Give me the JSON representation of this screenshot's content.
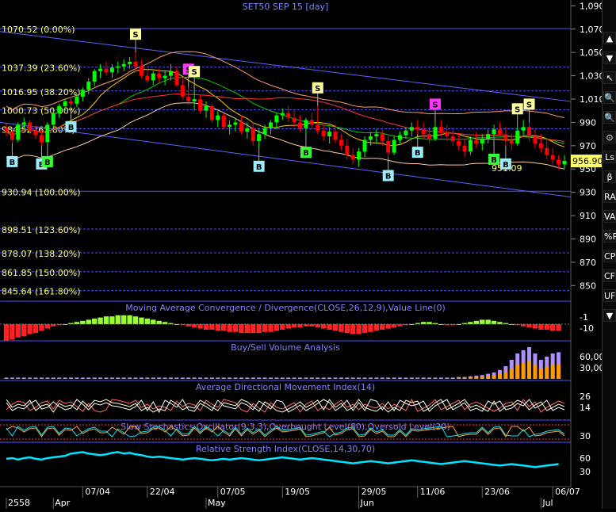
{
  "title": "SET50 SEP 15   [day]",
  "colors": {
    "background": "#000000",
    "up_candle": "#00ff00",
    "down_candle": "#ff0000",
    "fib_text": "#ffff66",
    "grid": "#1e1e78",
    "axis_text": "#ffffff",
    "panel_title": "#8080ff",
    "rsi_line": "#00e5ff",
    "volume_buy": "#ff9900",
    "volume_sell": "#b090ff"
  },
  "price_axis": {
    "ticks": [
      "1,090",
      "1,070",
      "1,050",
      "1,030",
      "1,010",
      "990",
      "970",
      "950",
      "930",
      "910",
      "890",
      "870",
      "850"
    ],
    "last_price": "956.90"
  },
  "fib_levels": [
    {
      "label": "1070.52 (0.00%)",
      "value": 1070.52
    },
    {
      "label": "1037.39 (23.60%)",
      "value": 1037.39
    },
    {
      "label": "1016.95 (38.20%)",
      "value": 1016.95
    },
    {
      "label": "1000.73 (50.00%)",
      "value": 1000.73
    },
    {
      "label": "984.52 (61.80%)",
      "value": 984.52
    },
    {
      "label": "930.94 (100.00%)",
      "value": 930.94
    },
    {
      "label": "898.51 (123.60%)",
      "value": 898.51
    },
    {
      "label": "878.07 (138.20%)",
      "value": 878.07
    },
    {
      "label": "861.85 (150.00%)",
      "value": 861.85
    },
    {
      "label": "845.64 (161.80%)",
      "value": 845.64
    }
  ],
  "price_annotation": "951.09",
  "signals": [
    {
      "type": "S",
      "index": 22
    },
    {
      "type": "S",
      "index": 31
    },
    {
      "type": "S",
      "index": 32
    },
    {
      "type": "S",
      "index": 53
    },
    {
      "type": "S",
      "index": 73
    },
    {
      "type": "S",
      "index": 87
    },
    {
      "type": "S",
      "index": 89
    },
    {
      "type": "B",
      "index": 1
    },
    {
      "type": "B",
      "index": 6
    },
    {
      "type": "B",
      "index": 7
    },
    {
      "type": "B",
      "index": 11
    },
    {
      "type": "B",
      "index": 43
    },
    {
      "type": "B",
      "index": 51
    },
    {
      "type": "B",
      "index": 65
    },
    {
      "type": "B",
      "index": 70
    },
    {
      "type": "B",
      "index": 83
    },
    {
      "type": "B",
      "index": 85
    }
  ],
  "panels": {
    "macd": {
      "title": "Moving Average Convergence / Divergence(CLOSE,26,12,9),Value Line(0)",
      "ticks": [
        "-1",
        "-10"
      ]
    },
    "volume": {
      "title": "Buy/Sell Volume Analysis",
      "ticks": [
        "60,000",
        "30,000"
      ]
    },
    "adx": {
      "title": "Average Directional Movement Index(14)",
      "ticks": [
        "26",
        "14"
      ]
    },
    "stoch": {
      "title": "Slow Stochastics Oscillator(9,3,3),Overbought Level(80),Oversold Level(20)",
      "ticks": [
        "30"
      ]
    },
    "rsi": {
      "title": "Relative Strength Index(CLOSE,14,30,70)",
      "ticks": [
        "60",
        "30"
      ]
    }
  },
  "date_axis": {
    "dates": [
      {
        "label": "07/04",
        "index": 13
      },
      {
        "label": "22/04",
        "index": 24
      },
      {
        "label": "07/05",
        "index": 36
      },
      {
        "label": "19/05",
        "index": 47
      },
      {
        "label": "29/05",
        "index": 60
      },
      {
        "label": "11/06",
        "index": 70
      },
      {
        "label": "23/06",
        "index": 81
      },
      {
        "label": "06/07",
        "index": 93
      }
    ],
    "months": [
      {
        "label": "2558",
        "index": 0
      },
      {
        "label": "Apr",
        "index": 8
      },
      {
        "label": "May",
        "index": 34
      },
      {
        "label": "Jun",
        "index": 60
      },
      {
        "label": "Jul",
        "index": 91
      }
    ]
  },
  "toolbar": [
    "▲",
    "▼",
    "↖",
    "🔍",
    "🔍",
    "⊙",
    "Ls",
    "β",
    "RA",
    "VA",
    "%P",
    "CP",
    "CF",
    "UF",
    "▼"
  ],
  "chart_data": {
    "type": "candlestick",
    "title": "SET50 SEP 15   [day]",
    "ylim": [
      840,
      1095
    ],
    "candles": [
      [
        985,
        989,
        978,
        982
      ],
      [
        982,
        986,
        972,
        975
      ],
      [
        975,
        990,
        973,
        988
      ],
      [
        988,
        994,
        984,
        990
      ],
      [
        990,
        992,
        980,
        983
      ],
      [
        983,
        988,
        976,
        979
      ],
      [
        979,
        984,
        970,
        973
      ],
      [
        973,
        990,
        972,
        988
      ],
      [
        988,
        1000,
        985,
        998
      ],
      [
        998,
        1006,
        994,
        1004
      ],
      [
        1004,
        1010,
        1000,
        1008
      ],
      [
        1008,
        1012,
        1002,
        1006
      ],
      [
        1006,
        1014,
        1003,
        1012
      ],
      [
        1012,
        1020,
        1008,
        1018
      ],
      [
        1018,
        1028,
        1014,
        1025
      ],
      [
        1025,
        1036,
        1021,
        1034
      ],
      [
        1034,
        1040,
        1028,
        1036
      ],
      [
        1036,
        1042,
        1030,
        1033
      ],
      [
        1033,
        1040,
        1028,
        1037
      ],
      [
        1037,
        1042,
        1032,
        1038
      ],
      [
        1038,
        1044,
        1034,
        1040
      ],
      [
        1040,
        1046,
        1036,
        1042
      ],
      [
        1042,
        1050,
        1034,
        1038
      ],
      [
        1038,
        1044,
        1028,
        1030
      ],
      [
        1030,
        1036,
        1024,
        1026
      ],
      [
        1026,
        1034,
        1022,
        1032
      ],
      [
        1032,
        1036,
        1024,
        1028
      ],
      [
        1028,
        1034,
        1022,
        1030
      ],
      [
        1030,
        1040,
        1026,
        1034
      ],
      [
        1034,
        1038,
        1020,
        1022
      ],
      [
        1022,
        1028,
        1010,
        1012
      ],
      [
        1012,
        1020,
        1005,
        1008
      ],
      [
        1008,
        1018,
        1000,
        1010
      ],
      [
        1010,
        1014,
        998,
        1000
      ],
      [
        1000,
        1008,
        994,
        1004
      ],
      [
        1004,
        1006,
        990,
        992
      ],
      [
        992,
        1000,
        986,
        996
      ],
      [
        996,
        998,
        984,
        986
      ],
      [
        986,
        992,
        980,
        988
      ],
      [
        988,
        994,
        982,
        990
      ],
      [
        990,
        996,
        980,
        982
      ],
      [
        982,
        990,
        976,
        985
      ],
      [
        985,
        990,
        970,
        974
      ],
      [
        974,
        984,
        968,
        980
      ],
      [
        980,
        988,
        976,
        985
      ],
      [
        985,
        992,
        980,
        990
      ],
      [
        990,
        998,
        984,
        996
      ],
      [
        996,
        1002,
        992,
        998
      ],
      [
        998,
        1004,
        990,
        994
      ],
      [
        994,
        1000,
        986,
        990
      ],
      [
        990,
        996,
        982,
        985
      ],
      [
        985,
        994,
        980,
        992
      ],
      [
        992,
        998,
        984,
        988
      ],
      [
        988,
        1004,
        980,
        983
      ],
      [
        983,
        990,
        974,
        978
      ],
      [
        978,
        986,
        972,
        982
      ],
      [
        982,
        988,
        972,
        975
      ],
      [
        975,
        980,
        966,
        970
      ],
      [
        970,
        976,
        958,
        962
      ],
      [
        962,
        968,
        954,
        958
      ],
      [
        958,
        968,
        952,
        965
      ],
      [
        965,
        978,
        960,
        975
      ],
      [
        975,
        982,
        970,
        978
      ],
      [
        978,
        984,
        972,
        980
      ],
      [
        980,
        984,
        970,
        974
      ],
      [
        974,
        980,
        960,
        964
      ],
      [
        964,
        978,
        962,
        975
      ],
      [
        975,
        982,
        972,
        979
      ],
      [
        979,
        986,
        976,
        983
      ],
      [
        983,
        990,
        978,
        986
      ],
      [
        986,
        992,
        980,
        984
      ],
      [
        984,
        990,
        976,
        980
      ],
      [
        980,
        986,
        972,
        976
      ],
      [
        976,
        990,
        974,
        986
      ],
      [
        986,
        992,
        978,
        982
      ],
      [
        982,
        988,
        974,
        978
      ],
      [
        978,
        984,
        970,
        974
      ],
      [
        974,
        980,
        966,
        970
      ],
      [
        970,
        976,
        960,
        965
      ],
      [
        965,
        978,
        962,
        975
      ],
      [
        975,
        982,
        968,
        972
      ],
      [
        972,
        980,
        966,
        976
      ],
      [
        976,
        984,
        972,
        980
      ],
      [
        980,
        988,
        974,
        984
      ],
      [
        984,
        990,
        978,
        980
      ],
      [
        980,
        986,
        970,
        974
      ],
      [
        974,
        980,
        966,
        972
      ],
      [
        972,
        986,
        970,
        983
      ],
      [
        983,
        992,
        978,
        986
      ],
      [
        986,
        990,
        974,
        978
      ],
      [
        978,
        984,
        968,
        972
      ],
      [
        972,
        980,
        964,
        968
      ],
      [
        968,
        976,
        958,
        962
      ],
      [
        962,
        968,
        954,
        958
      ],
      [
        958,
        962,
        950,
        954
      ],
      [
        954,
        962,
        950,
        957
      ]
    ],
    "bands": {
      "upper_start": 1068,
      "upper_end": 1008,
      "lower_start": 990,
      "lower_end": 926
    },
    "rsi": [
      55,
      56,
      54,
      56,
      57,
      55,
      54,
      56,
      57,
      58,
      59,
      62,
      63,
      64,
      62,
      61,
      60,
      61,
      63,
      64,
      62,
      63,
      61,
      60,
      58,
      57,
      58,
      57,
      56,
      55,
      54,
      55,
      56,
      55,
      54,
      53,
      54,
      55,
      54,
      55,
      56,
      55,
      54,
      53,
      54,
      55,
      56,
      57,
      56,
      55,
      54,
      55,
      56,
      55,
      54,
      53,
      52,
      51,
      50,
      49,
      50,
      51,
      52,
      51,
      50,
      49,
      50,
      51,
      52,
      53,
      52,
      51,
      50,
      49,
      48,
      49,
      50,
      51,
      52,
      51,
      50,
      49,
      48,
      47,
      46,
      47,
      48,
      47,
      46,
      45,
      44,
      45,
      46,
      47,
      48
    ],
    "macd_hist": [
      -15,
      -14,
      -12,
      -11,
      -9,
      -8,
      -6,
      -4,
      -2,
      -1,
      0,
      1,
      2,
      3,
      4,
      5,
      6,
      7,
      7,
      8,
      8,
      8,
      7,
      6,
      5,
      4,
      3,
      2,
      1,
      0,
      -1,
      -2,
      -3,
      -4,
      -5,
      -5,
      -6,
      -6,
      -7,
      -7,
      -8,
      -8,
      -8,
      -8,
      -7,
      -7,
      -6,
      -5,
      -4,
      -3,
      -3,
      -2,
      -2,
      -3,
      -4,
      -5,
      -6,
      -7,
      -8,
      -9,
      -9,
      -8,
      -7,
      -6,
      -5,
      -4,
      -3,
      -2,
      -1,
      0,
      1,
      2,
      2,
      1,
      0,
      -1,
      -1,
      0,
      1,
      2,
      3,
      4,
      4,
      3,
      2,
      1,
      0,
      -1,
      -2,
      -3,
      -4,
      -5,
      -5,
      -6,
      -6
    ],
    "volume": [
      2,
      2,
      2,
      2,
      2,
      2,
      2,
      2,
      2,
      2,
      2,
      2,
      2,
      2,
      2,
      2,
      2,
      2,
      2,
      2,
      2,
      2,
      2,
      2,
      2,
      2,
      2,
      2,
      2,
      2,
      2,
      2,
      2,
      2,
      2,
      2,
      2,
      2,
      2,
      2,
      2,
      2,
      2,
      2,
      2,
      2,
      2,
      2,
      2,
      2,
      2,
      2,
      2,
      2,
      2,
      2,
      2,
      2,
      2,
      2,
      2,
      2,
      2,
      2,
      2,
      2,
      2,
      2,
      2,
      2,
      2,
      2,
      2,
      2,
      2,
      2,
      2,
      3,
      3,
      4,
      5,
      6,
      8,
      10,
      14,
      20,
      30,
      40,
      45,
      50,
      40,
      30,
      35,
      40,
      42
    ]
  }
}
